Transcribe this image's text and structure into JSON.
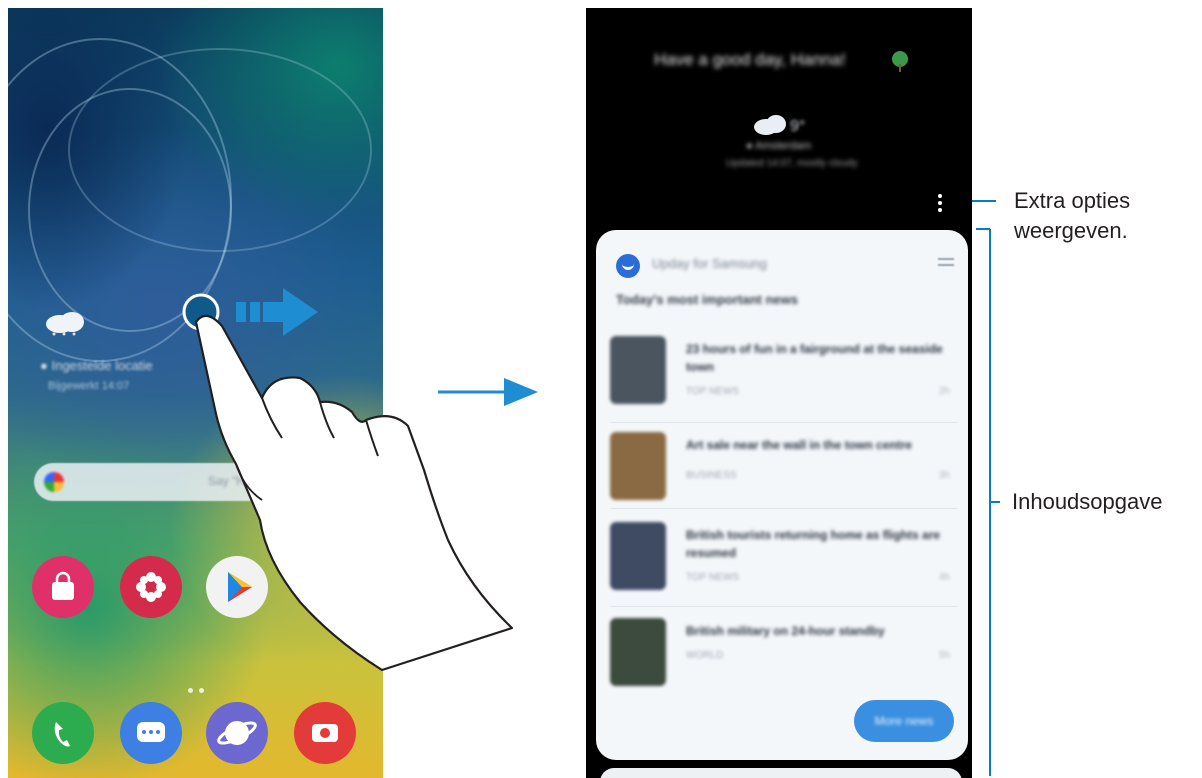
{
  "home_screen": {
    "weather": {
      "location": "Ingestelde locatie",
      "updated": "Bijgewerkt 14:07"
    },
    "search": {
      "hint": "Say \"Hey Google\""
    },
    "apps": [
      {
        "name": "Galaxy Store",
        "icon": "store-icon",
        "color": "#e0306a"
      },
      {
        "name": "Galaxy Apps",
        "icon": "flower-icon",
        "color": "#d42a4b"
      },
      {
        "name": "Play Store",
        "icon": "play-store-icon",
        "color": "#f2f2f2"
      },
      {
        "name": "Telefoon",
        "icon": "phone-icon",
        "color": "#2cab4f"
      },
      {
        "name": "Berichten",
        "icon": "messages-icon",
        "color": "#3d7fe3"
      },
      {
        "name": "Internet",
        "icon": "internet-icon",
        "color": "#6d68cf"
      },
      {
        "name": "Camera",
        "icon": "camera-icon",
        "color": "#e33a3a"
      }
    ]
  },
  "gesture": {
    "direction": "swipe-right",
    "hand_icon": "hand-pointer-icon",
    "arrow_icon": "arrow-right-icon"
  },
  "transition_arrow_icon": "arrow-right-icon",
  "discover_screen": {
    "greeting": "Have a good day, Hanna!",
    "weather_temp": "9°",
    "weather_location": "Amsterdam",
    "weather_detail": "Updated 14:07, mostly cloudy",
    "card": {
      "source": "Upday for Samsung",
      "subtitle": "Today's most important news",
      "news": [
        {
          "title": "23 hours of fun in a fairground at the seaside town",
          "meta": "TOP NEWS",
          "time": "2h",
          "thumb_color": "#4a5560"
        },
        {
          "title": "Art sale near the wall in the town centre",
          "meta": "BUSINESS",
          "time": "3h",
          "thumb_color": "#8a6a42"
        },
        {
          "title": "British tourists returning home as flights are resumed",
          "meta": "TOP NEWS",
          "time": "4h",
          "thumb_color": "#3e4b62"
        },
        {
          "title": "British military on 24-hour standby",
          "meta": "WORLD",
          "time": "5h",
          "thumb_color": "#3d4a3e"
        }
      ],
      "more_button": "More news"
    }
  },
  "annotations": {
    "extra_options": {
      "line1": "Extra opties",
      "line2": "weergeven."
    },
    "content": "Inhoudsopgave"
  },
  "colors": {
    "arrow_blue": "#1f8dd1",
    "line_blue": "#0a7cc1"
  }
}
